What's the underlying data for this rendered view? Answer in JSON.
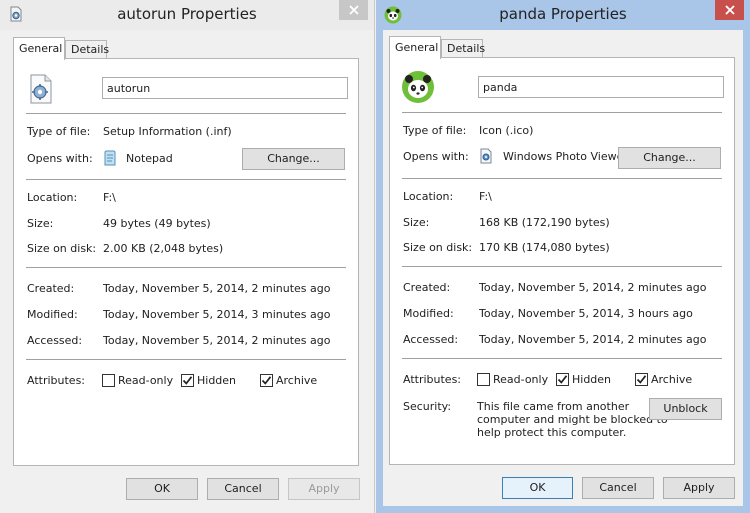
{
  "left_window": {
    "title": "autorun Properties",
    "tabs": [
      "General",
      "Details"
    ],
    "filename": "autorun",
    "type_label": "Type of file:",
    "type_value": "Setup Information (.inf)",
    "opens_label": "Opens with:",
    "opens_value": "Notepad",
    "change_label": "Change...",
    "location_label": "Location:",
    "location_value": "F:\\",
    "size_label": "Size:",
    "size_value": "49 bytes (49 bytes)",
    "disk_label": "Size on disk:",
    "disk_value": "2.00 KB (2,048 bytes)",
    "created_label": "Created:",
    "created_value": "Today, November 5, 2014, 2 minutes ago",
    "modified_label": "Modified:",
    "modified_value": "Today, November 5, 2014, 3 minutes ago",
    "accessed_label": "Accessed:",
    "accessed_value": "Today, November 5, 2014, 2 minutes ago",
    "attributes_label": "Attributes:",
    "readonly_label": "Read-only",
    "hidden_label": "Hidden",
    "archive_label": "Archive",
    "ok_label": "OK",
    "cancel_label": "Cancel",
    "apply_label": "Apply"
  },
  "right_window": {
    "title": "panda Properties",
    "tabs": [
      "General",
      "Details"
    ],
    "filename": "panda",
    "type_label": "Type of file:",
    "type_value": "Icon (.ico)",
    "opens_label": "Opens with:",
    "opens_value": "Windows Photo Viewer",
    "change_label": "Change...",
    "location_label": "Location:",
    "location_value": "F:\\",
    "size_label": "Size:",
    "size_value": "168 KB (172,190 bytes)",
    "disk_label": "Size on disk:",
    "disk_value": "170 KB (174,080 bytes)",
    "created_label": "Created:",
    "created_value": "Today, November 5, 2014, 2 minutes ago",
    "modified_label": "Modified:",
    "modified_value": "Today, November 5, 2014, 3 hours ago",
    "accessed_label": "Accessed:",
    "accessed_value": "Today, November 5, 2014, 2 minutes ago",
    "attributes_label": "Attributes:",
    "readonly_label": "Read-only",
    "hidden_label": "Hidden",
    "archive_label": "Archive",
    "security_label": "Security:",
    "security_line1": "This file came from another",
    "security_line2": "computer and might be blocked to",
    "security_line3": "help protect this computer.",
    "unblock_label": "Unblock",
    "ok_label": "OK",
    "cancel_label": "Cancel",
    "apply_label": "Apply"
  },
  "checkbox_state": {
    "readonly": false,
    "hidden": true,
    "archive": true
  },
  "colors": {
    "active_frame": "#a9c5e7",
    "inactive_frame": "#ebebeb",
    "close_active": "#c7504c"
  },
  "icons": {
    "left_title": "settings-file-icon",
    "right_title": "panda-icon",
    "notepad": "notepad-icon",
    "photo_viewer": "photo-viewer-icon"
  }
}
